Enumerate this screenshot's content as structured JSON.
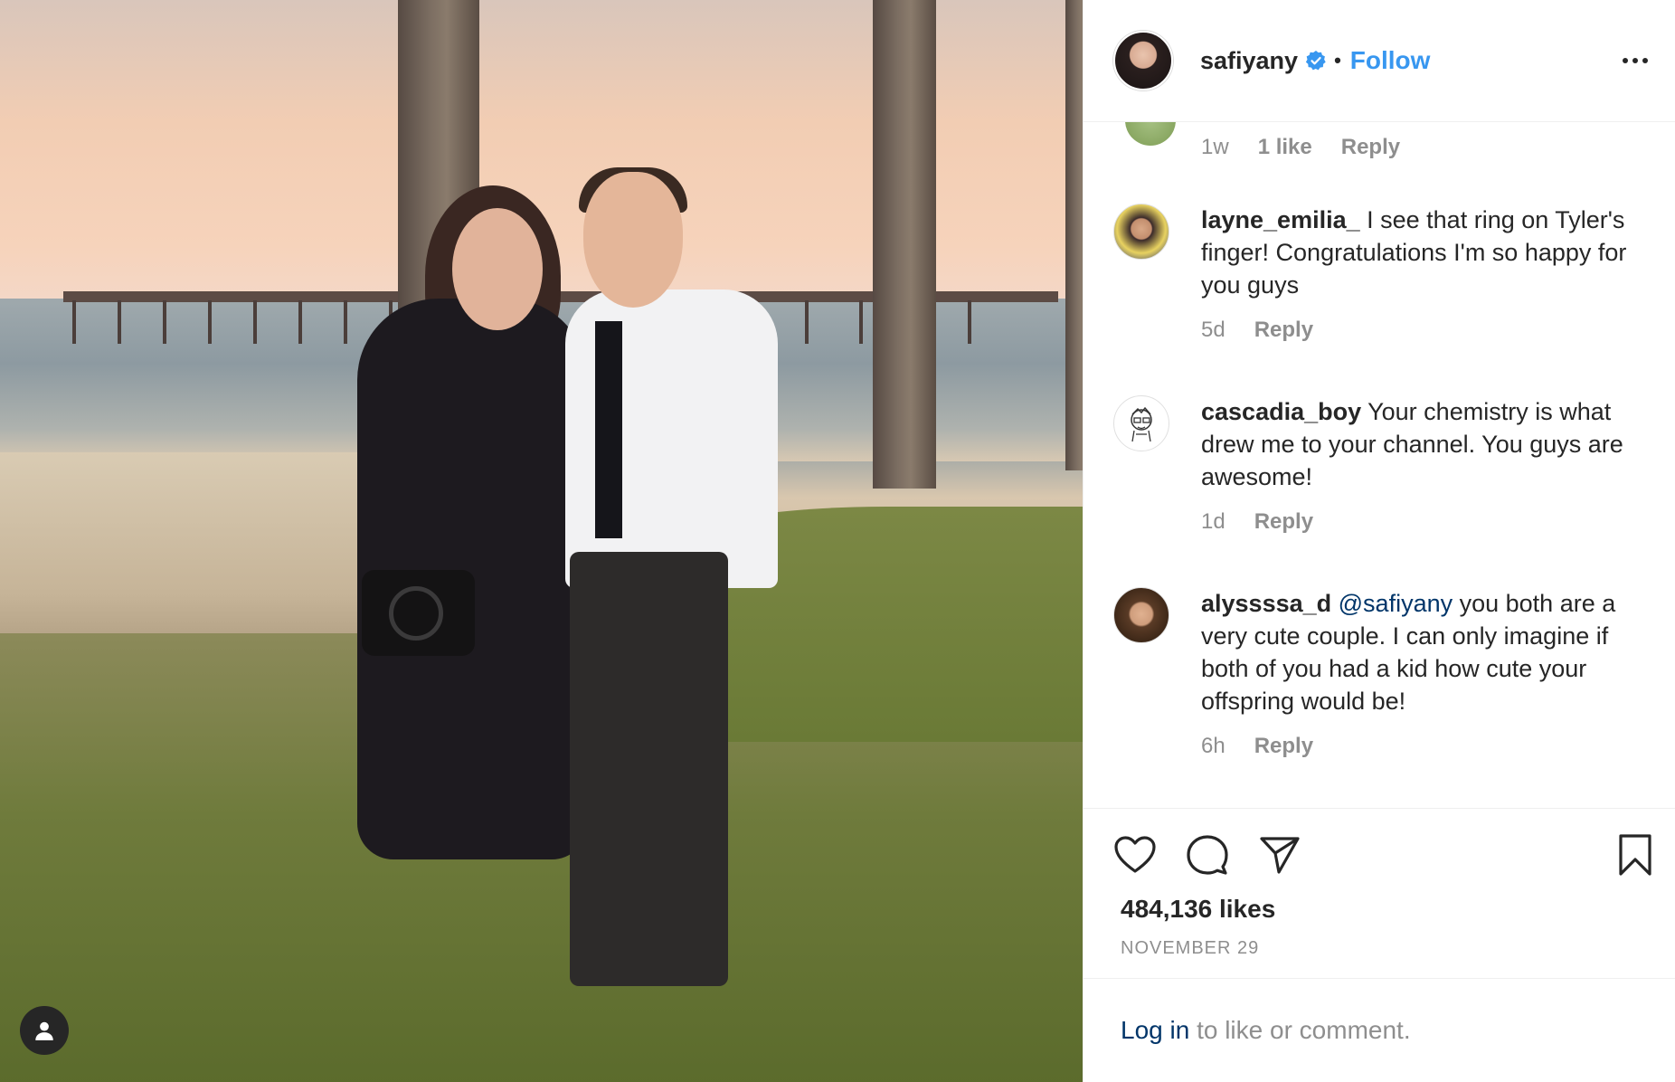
{
  "header": {
    "username": "safiyany",
    "separator": "•",
    "follow_label": "Follow"
  },
  "comments": {
    "first_meta": {
      "time": "1w",
      "likes": "1 like",
      "reply": "Reply"
    },
    "items": [
      {
        "username": "layne_emilia_",
        "text": " I see that ring on Tyler's finger! Congratulations I'm so happy for you guys",
        "time": "5d",
        "reply": "Reply"
      },
      {
        "username": "cascadia_boy",
        "text": " Your chemistry is what drew me to your channel. You guys are awesome!",
        "time": "1d",
        "reply": "Reply"
      },
      {
        "username": "alyssssa_d",
        "mention": "@safiyany",
        "text": " you both are a very cute couple. I can only imagine if both of you had a kid how cute your offspring would be!",
        "time": "6h",
        "reply": "Reply"
      }
    ]
  },
  "actions": {
    "like_icon": "heart-icon",
    "comment_icon": "comment-bubble-icon",
    "share_icon": "paper-plane-icon",
    "save_icon": "bookmark-icon",
    "likes_count": "484,136 likes",
    "date": "NOVEMBER 29"
  },
  "login": {
    "link": "Log in",
    "suffix": " to like or comment."
  },
  "colors": {
    "link_blue": "#3897f0",
    "mention_blue": "#003569",
    "meta_gray": "#8e8e8e",
    "text": "#262626"
  }
}
